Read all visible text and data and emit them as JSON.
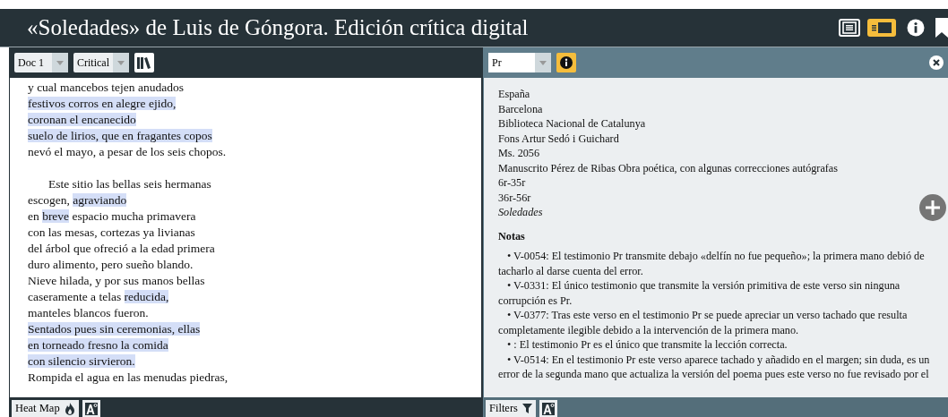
{
  "header": {
    "title": "«Soledades» de Luis de Góngora. Edición crítica digital",
    "view_buttons": [
      {
        "kind": "single",
        "selected": false
      },
      {
        "kind": "parallel",
        "selected": true
      }
    ]
  },
  "left_panel": {
    "document_select": "Doc 1",
    "edition_select": "Critical",
    "stanzas": [
      {
        "lines": [
          {
            "indent": false,
            "segments": [
              {
                "text": "y cual mancebos tejen anudados",
                "highlighted": false
              }
            ]
          },
          {
            "indent": false,
            "segments": [
              {
                "text": "festivos corros en alegre ejido,",
                "highlighted": true
              }
            ]
          },
          {
            "indent": false,
            "segments": [
              {
                "text": "coronan el encanecido",
                "highlighted": true
              }
            ]
          },
          {
            "indent": false,
            "segments": [
              {
                "text": "suelo de lirios, que en fragantes copos",
                "highlighted": true
              }
            ]
          },
          {
            "indent": false,
            "segments": [
              {
                "text": "nevó el mayo, a pesar de los seis chopos.",
                "highlighted": false
              }
            ]
          }
        ]
      },
      {
        "lines": [
          {
            "indent": true,
            "segments": [
              {
                "text": "Este sitio las bellas seis hermanas",
                "highlighted": false
              }
            ]
          },
          {
            "indent": false,
            "segments": [
              {
                "text": "escogen, ",
                "highlighted": false
              },
              {
                "text": "agraviando",
                "highlighted": true
              }
            ]
          },
          {
            "indent": false,
            "segments": [
              {
                "text": "en ",
                "highlighted": false
              },
              {
                "text": "breve",
                "highlighted": true
              },
              {
                "text": " espacio mucha primavera",
                "highlighted": false
              }
            ]
          },
          {
            "indent": false,
            "segments": [
              {
                "text": "con las mesas, cortezas ya livianas",
                "highlighted": false
              }
            ]
          },
          {
            "indent": false,
            "segments": [
              {
                "text": "del árbol que ofreció a la edad primera",
                "highlighted": false
              }
            ]
          },
          {
            "indent": false,
            "segments": [
              {
                "text": "duro alimento, pero sueño blando.",
                "highlighted": false
              }
            ]
          },
          {
            "indent": false,
            "segments": [
              {
                "text": "Nieve hilada, y por sus manos bellas",
                "highlighted": false
              }
            ]
          },
          {
            "indent": false,
            "segments": [
              {
                "text": "caseramente a telas ",
                "highlighted": false
              },
              {
                "text": "reducida,",
                "highlighted": true
              }
            ]
          },
          {
            "indent": false,
            "segments": [
              {
                "text": "manteles blancos fueron.",
                "highlighted": false
              }
            ]
          },
          {
            "indent": false,
            "segments": [
              {
                "text": "Sentados pues sin ceremonias, ellas",
                "highlighted": true
              }
            ]
          },
          {
            "indent": false,
            "segments": [
              {
                "text": "en torneado fresno la comida",
                "highlighted": true
              }
            ]
          },
          {
            "indent": false,
            "segments": [
              {
                "text": "con silencio sirvieron.",
                "highlighted": true
              }
            ]
          },
          {
            "indent": false,
            "segments": [
              {
                "text": "Rompida el agua en las menudas piedras,",
                "highlighted": false
              }
            ]
          }
        ]
      }
    ],
    "footer_button": "Heat Map"
  },
  "right_panel": {
    "witness_select": "Pr",
    "info_active": true,
    "metadata": [
      {
        "text": "España",
        "italic": false
      },
      {
        "text": "Barcelona",
        "italic": false
      },
      {
        "text": "Biblioteca Nacional de Catalunya",
        "italic": false
      },
      {
        "text": "Fons Artur Sedó i Guichard",
        "italic": false
      },
      {
        "text": "Ms. 2056",
        "italic": false
      },
      {
        "text": "Manuscrito Pérez de Ribas Obra poética, con algunas correcciones autógrafas",
        "italic": false
      },
      {
        "text": "6r-35r",
        "italic": false
      },
      {
        "text": "36r-56r",
        "italic": false
      },
      {
        "text": "Soledades",
        "italic": true
      }
    ],
    "notes_heading": "Notas",
    "notes": [
      {
        "bullet": "•",
        "text": "V-0054: El testimonio Pr transmite debajo «delfín no fue pequeño»; la primera mano debió de tacharlo al darse cuenta del error."
      },
      {
        "bullet": "•",
        "text": "V-0331: El único testimonio que transmite la versión primitiva de este verso sin ninguna corrupción es Pr."
      },
      {
        "bullet": "•",
        "text": "V-0377: Tras este verso en el testimonio Pr se puede apreciar un verso tachado que resulta completamente ilegible debido a la intervención de la primera mano."
      },
      {
        "bullet": "•",
        "text": ": El testimonio Pr es el único que transmite la lección correcta."
      },
      {
        "bullet": "•",
        "text": "V-0514: En el testimonio Pr este verso aparece tachado y añadido en el margen; sin duda, es un error de la segunda mano que actualiza la versión del poema pues este verso no fue revisado por el"
      }
    ],
    "footer_button": "Filters"
  }
}
